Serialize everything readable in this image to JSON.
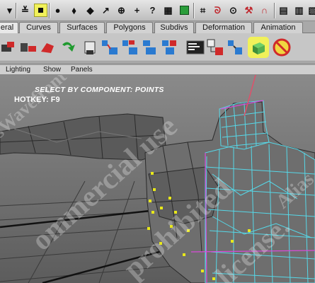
{
  "shelf_tabs": [
    {
      "label": "eral",
      "active": true
    },
    {
      "label": "Curves",
      "active": false
    },
    {
      "label": "Surfaces",
      "active": false
    },
    {
      "label": "Polygons",
      "active": false
    },
    {
      "label": "Subdivs",
      "active": false
    },
    {
      "label": "Deformation",
      "active": false
    },
    {
      "label": "Animation",
      "active": false
    }
  ],
  "panel_menu": {
    "lighting": "Lighting",
    "show": "Show",
    "panels": "Panels"
  },
  "viewport": {
    "title": "SELECT BY COMPONENT: POINTS",
    "hotkey": "HOTKEY: F9"
  },
  "colors": {
    "highlight": "#f1f15a",
    "wireframe": "#56d8e8",
    "selection_vertex": "#e8e81a",
    "leader_line": "#e0506a"
  }
}
